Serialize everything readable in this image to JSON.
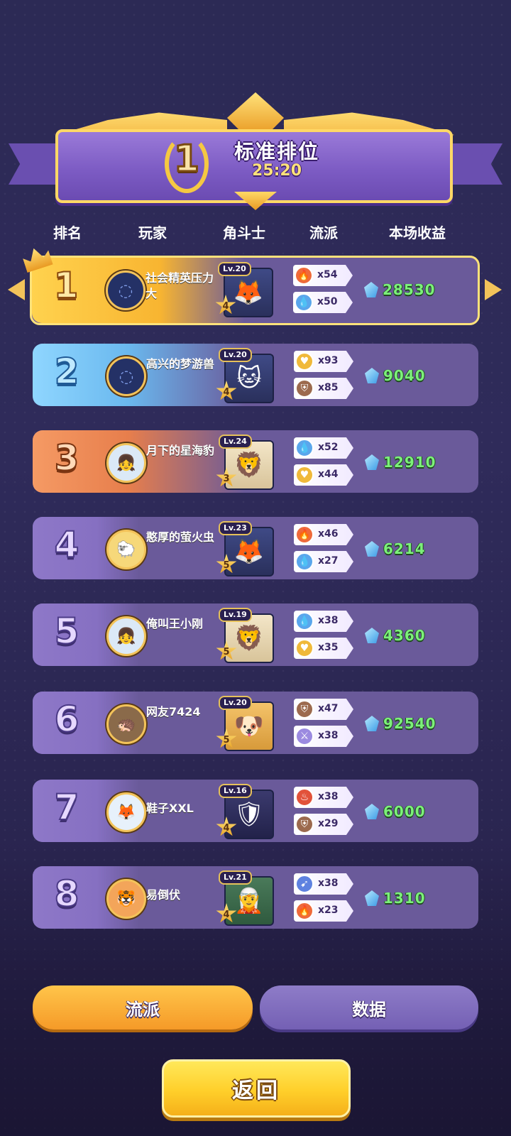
{
  "header": {
    "rank": "1",
    "title": "标准排位",
    "time": "25:20"
  },
  "columns": {
    "rank": "排名",
    "player": "玩家",
    "hero": "角斗士",
    "faction": "流派",
    "earnings": "本场收益"
  },
  "rows": [
    {
      "rank": "1",
      "name": "社会精英压力大",
      "avatar": "loading-icon",
      "hero_level": "Lv.20",
      "hero_stars": "4",
      "hero_icon": "fox-hero-icon",
      "factions": [
        {
          "icon": "fire-icon",
          "count": "x54"
        },
        {
          "icon": "water-drop-icon",
          "count": "x50"
        }
      ],
      "earnings": "28530"
    },
    {
      "rank": "2",
      "name": "高兴的梦游兽",
      "avatar": "loading-icon",
      "hero_level": "Lv.20",
      "hero_stars": "4",
      "hero_icon": "pirate-cat-hero-icon",
      "factions": [
        {
          "icon": "heart-icon",
          "count": "x93"
        },
        {
          "icon": "shield-icon",
          "count": "x85"
        }
      ],
      "earnings": "9040"
    },
    {
      "rank": "3",
      "name": "月下的星海豹",
      "avatar": "girl-avatar-icon",
      "hero_level": "Lv.24",
      "hero_stars": "3",
      "hero_icon": "lion-hero-icon",
      "factions": [
        {
          "icon": "water-drop-icon",
          "count": "x52"
        },
        {
          "icon": "heart-icon",
          "count": "x44"
        }
      ],
      "earnings": "12910"
    },
    {
      "rank": "4",
      "name": "憨厚的萤火虫",
      "avatar": "sheep-avatar-icon",
      "hero_level": "Lv.23",
      "hero_stars": "5",
      "hero_icon": "fox-hero-icon",
      "factions": [
        {
          "icon": "fire-icon",
          "count": "x46"
        },
        {
          "icon": "water-drop-icon",
          "count": "x27"
        }
      ],
      "earnings": "6214"
    },
    {
      "rank": "5",
      "name": "俺叫王小刚",
      "avatar": "girl-avatar-icon",
      "hero_level": "Lv.19",
      "hero_stars": "5",
      "hero_icon": "lion-hero-icon",
      "factions": [
        {
          "icon": "water-drop-icon",
          "count": "x38"
        },
        {
          "icon": "heart-icon",
          "count": "x35"
        }
      ],
      "earnings": "4360"
    },
    {
      "rank": "6",
      "name": "网友7424",
      "avatar": "hedgehog-avatar-icon",
      "hero_level": "Lv.20",
      "hero_stars": "5",
      "hero_icon": "dog-hero-icon",
      "factions": [
        {
          "icon": "shield-icon",
          "count": "x47"
        },
        {
          "icon": "sword-icon",
          "count": "x38"
        }
      ],
      "earnings": "92540"
    },
    {
      "rank": "7",
      "name": "鞋子XXL",
      "avatar": "fox-mask-avatar-icon",
      "hero_level": "Lv.16",
      "hero_stars": "4",
      "hero_icon": "knight-hero-icon",
      "factions": [
        {
          "icon": "flame-icon",
          "count": "x38"
        },
        {
          "icon": "shield-icon",
          "count": "x29"
        }
      ],
      "earnings": "6000"
    },
    {
      "rank": "8",
      "name": "易倒伏",
      "avatar": "tiger-avatar-icon",
      "hero_level": "Lv.21",
      "hero_stars": "4",
      "hero_icon": "elf-hero-icon",
      "factions": [
        {
          "icon": "arrow-icon",
          "count": "x38"
        },
        {
          "icon": "fire-icon",
          "count": "x23"
        }
      ],
      "earnings": "1310"
    }
  ],
  "tabs": {
    "faction": "流派",
    "data": "数据"
  },
  "back_button": "返回",
  "colors": {
    "gold": "#ffd24e",
    "silver_blue": "#8fd6ff",
    "bronze": "#f59a64",
    "purple_row": "#6a5a9a",
    "earnings_green": "#7cf07a"
  }
}
